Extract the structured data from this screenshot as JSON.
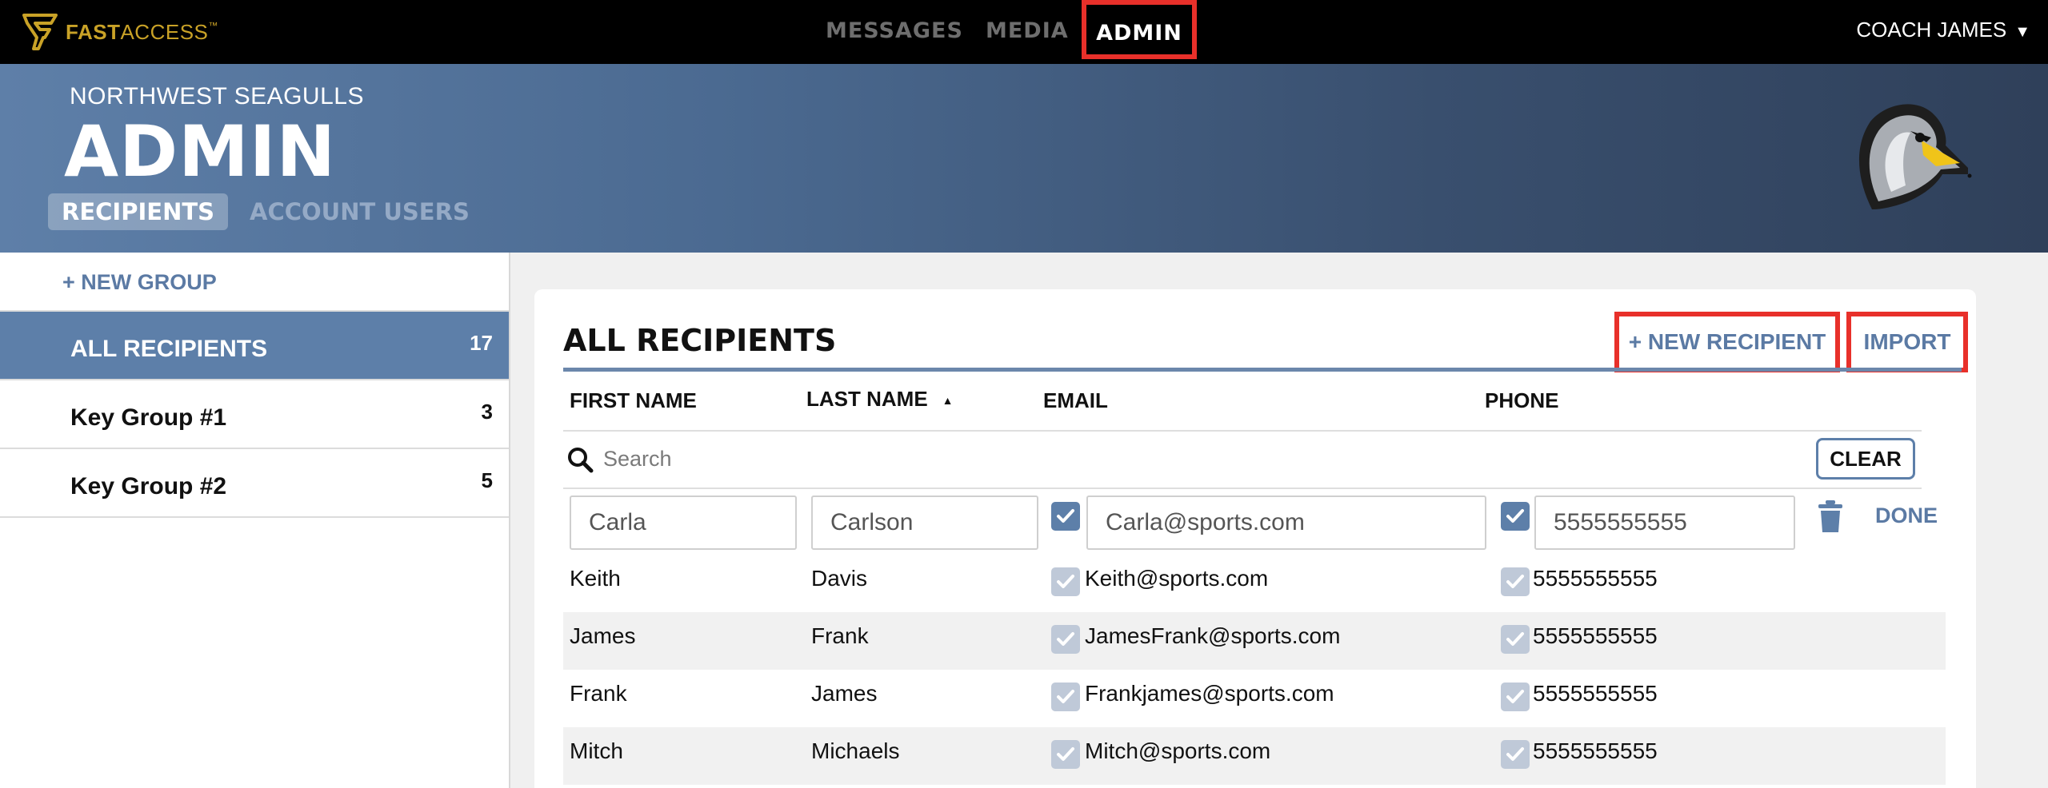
{
  "topnav": {
    "logo_bold": "FAST",
    "logo_light": "ACCESS",
    "logo_tm": "™",
    "items": [
      "MESSAGES",
      "MEDIA",
      "ADMIN"
    ],
    "user": "COACH JAMES",
    "user_caret": "▼"
  },
  "header": {
    "org": "NORTHWEST SEAGULLS",
    "title": "ADMIN",
    "tabs": [
      "RECIPIENTS",
      "ACCOUNT USERS"
    ]
  },
  "sidebar": {
    "new_group": "+ NEW GROUP",
    "groups": [
      {
        "label": "ALL RECIPIENTS",
        "count": "17"
      },
      {
        "label": "Key Group #1",
        "count": "3"
      },
      {
        "label": "Key Group #2",
        "count": "5"
      }
    ]
  },
  "main": {
    "title": "ALL RECIPIENTS",
    "new_recipient": "+ NEW RECIPIENT",
    "import": "IMPORT",
    "columns": [
      "FIRST NAME",
      "LAST NAME",
      "EMAIL",
      "PHONE"
    ],
    "sort_indicator": "▲",
    "search_placeholder": "Search",
    "clear": "CLEAR",
    "done": "DONE",
    "editing": {
      "first": "Carla",
      "last": "Carlson",
      "email": "Carla@sports.com",
      "phone": "5555555555"
    },
    "rows": [
      {
        "first": "Keith",
        "last": "Davis",
        "email": "Keith@sports.com",
        "phone": "5555555555"
      },
      {
        "first": "James",
        "last": "Frank",
        "email": "JamesFrank@sports.com",
        "phone": "5555555555"
      },
      {
        "first": "Frank",
        "last": "James",
        "email": "Frankjames@sports.com",
        "phone": "5555555555"
      },
      {
        "first": "Mitch",
        "last": "Michaels",
        "email": "Mitch@sports.com",
        "phone": "5555555555"
      }
    ]
  },
  "colors": {
    "accent": "#5d7fa9",
    "highlight": "#e8302a",
    "nav_bg": "#000000",
    "logo": "#c9a227"
  }
}
